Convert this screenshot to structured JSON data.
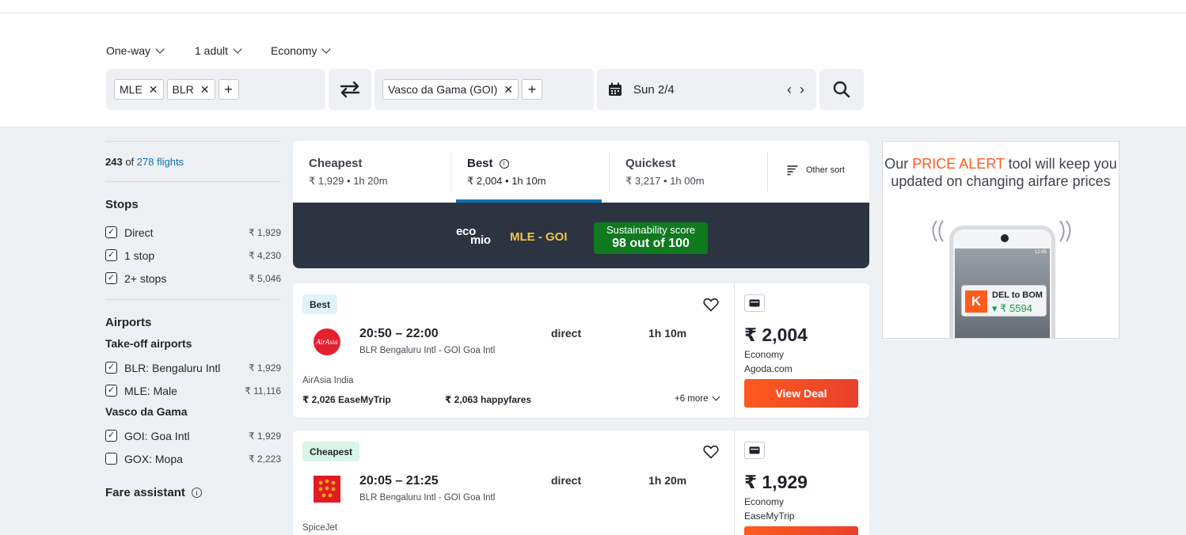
{
  "search": {
    "trip_type": "One-way",
    "travelers": "1 adult",
    "cabin": "Economy",
    "origins": [
      "MLE",
      "BLR"
    ],
    "destination": "Vasco da Gama (GOI)",
    "date": "Sun 2/4"
  },
  "filters": {
    "count_shown": "243",
    "count_of": "of",
    "count_total": "278 flights",
    "stops_title": "Stops",
    "stops": [
      {
        "label": "Direct",
        "price": "₹ 1,929",
        "checked": true
      },
      {
        "label": "1 stop",
        "price": "₹ 4,230",
        "checked": true
      },
      {
        "label": "2+ stops",
        "price": "₹ 5,046",
        "checked": true
      }
    ],
    "airports_title": "Airports",
    "takeoff_title": "Take-off airports",
    "takeoff": [
      {
        "label": "BLR: Bengaluru Intl",
        "price": "₹ 1,929",
        "checked": true
      },
      {
        "label": "MLE: Male",
        "price": "₹ 11,116",
        "checked": true
      }
    ],
    "landing_title": "Vasco da Gama",
    "landing": [
      {
        "label": "GOI: Goa Intl",
        "price": "₹ 1,929",
        "checked": true
      },
      {
        "label": "GOX: Mopa",
        "price": "₹ 2,223",
        "checked": false
      }
    ],
    "fare_assistant": "Fare assistant"
  },
  "sort": {
    "cheapest": {
      "title": "Cheapest",
      "sub": "₹ 1,929 • 1h 20m"
    },
    "best": {
      "title": "Best",
      "sub": "₹ 2,004 • 1h 10m"
    },
    "quickest": {
      "title": "Quickest",
      "sub": "₹ 3,217 • 1h 00m"
    },
    "other": "Other sort"
  },
  "eco": {
    "logo_top": "eco",
    "logo_bottom": "mio",
    "route": "MLE - GOI",
    "score_label": "Sustainability score",
    "score_value": "98 out of 100"
  },
  "results": [
    {
      "badge": "Best",
      "times": "20:50 – 22:00",
      "route": "BLR  Bengaluru Intl - GOI  Goa Intl",
      "stops": "direct",
      "duration": "1h 10m",
      "airline": "AirAsia India",
      "alt1": "₹ 2,026  EaseMyTrip",
      "alt2": "₹ 2,063  happyfares",
      "more": "+6 more",
      "price": "₹ 2,004",
      "cabin": "Economy",
      "provider": "Agoda.com",
      "cta": "View Deal"
    },
    {
      "badge": "Cheapest",
      "times": "20:05 – 21:25",
      "route": "BLR  Bengaluru Intl - GOI  Goa Intl",
      "stops": "direct",
      "duration": "1h 20m",
      "airline": "SpiceJet",
      "price": "₹ 1,929",
      "cabin": "Economy",
      "provider": "EaseMyTrip"
    }
  ],
  "ad": {
    "line1_pre": "Our ",
    "line1_hl": "PRICE ALERT",
    "line1_post": " tool will keep you",
    "line2": "updated on changing airfare prices",
    "notif_route": "DEL to BOM",
    "notif_price": "▾ ₹ 5594",
    "notif_logo": "K",
    "clock": "12:45"
  },
  "colors": {
    "accent": "#0f6fb3",
    "cta": "#ff5a1f",
    "eco_bg": "#2b3440",
    "eco_score": "#0f7a1f"
  }
}
